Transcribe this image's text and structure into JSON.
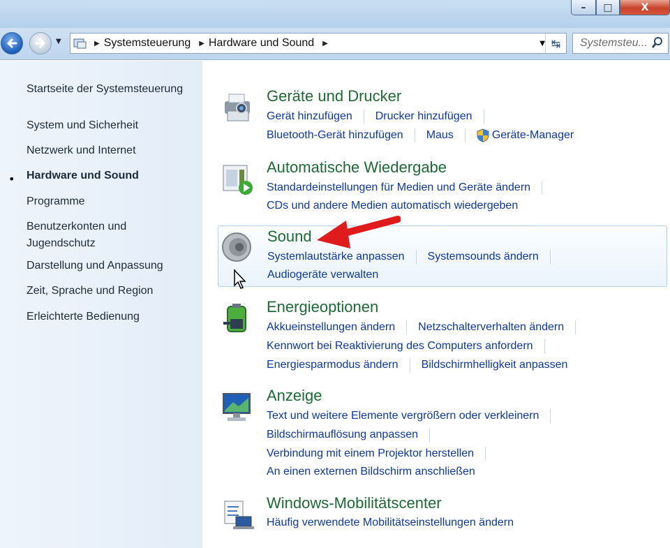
{
  "window": {
    "controls": {
      "minimize": "–",
      "maximize": "□",
      "close": "X"
    }
  },
  "address": {
    "breadcrumbs": [
      "Systemsteuerung",
      "Hardware und Sound"
    ],
    "search_placeholder": "Systemsteu..."
  },
  "sidebar": {
    "items": [
      "Startseite der Systemsteuerung",
      "System und Sicherheit",
      "Netzwerk und Internet",
      "Hardware und Sound",
      "Programme",
      "Benutzerkonten und",
      "Jugendschutz",
      "Darstellung und Anpassung",
      "Zeit, Sprache und Region",
      "Erleichterte Bedienung"
    ],
    "active_index": 3
  },
  "categories": [
    {
      "title": "Geräte und Drucker",
      "icon": "printer-camera-icon",
      "rows": [
        [
          "Gerät hinzufügen",
          "Drucker hinzufügen"
        ],
        [
          "Bluetooth-Gerät hinzufügen",
          "Maus",
          "Geräte-Manager"
        ]
      ]
    },
    {
      "title": "Automatische Wiedergabe",
      "icon": "autoplay-icon",
      "rows": [
        [
          "Standardeinstellungen für Medien und Geräte ändern"
        ],
        [
          "CDs und andere Medien automatisch wiedergeben"
        ]
      ]
    },
    {
      "title": "Sound",
      "icon": "speaker-icon",
      "rows": [
        [
          "Systemlautstärke anpassen",
          "Systemsounds ändern"
        ],
        [
          "Audiogeräte verwalten"
        ]
      ]
    },
    {
      "title": "Energieoptionen",
      "icon": "battery-icon",
      "rows": [
        [
          "Akkueinstellungen ändern",
          "Netzschalterverhalten ändern"
        ],
        [
          "Kennwort bei Reaktivierung des Computers anfordern"
        ],
        [
          "Energiesparmodus ändern",
          "Bildschirmhelligkeit anpassen"
        ]
      ]
    },
    {
      "title": "Anzeige",
      "icon": "monitor-icon",
      "rows": [
        [
          "Text und weitere Elemente vergrößern oder verkleinern"
        ],
        [
          "Bildschirmauflösung anpassen"
        ],
        [
          "Verbindung mit einem Projektor herstellen"
        ],
        [
          "An einen externen Bildschirm anschließen"
        ]
      ]
    },
    {
      "title": "Windows-Mobilitätscenter",
      "icon": "mobility-center-icon",
      "rows": [
        [
          "Häufig verwendete Mobilitätseinstellungen ändern"
        ]
      ]
    }
  ],
  "colors": {
    "link": "#0c38a5",
    "category_title": "#1e6a35",
    "annotation_arrow": "#e01b1b"
  }
}
